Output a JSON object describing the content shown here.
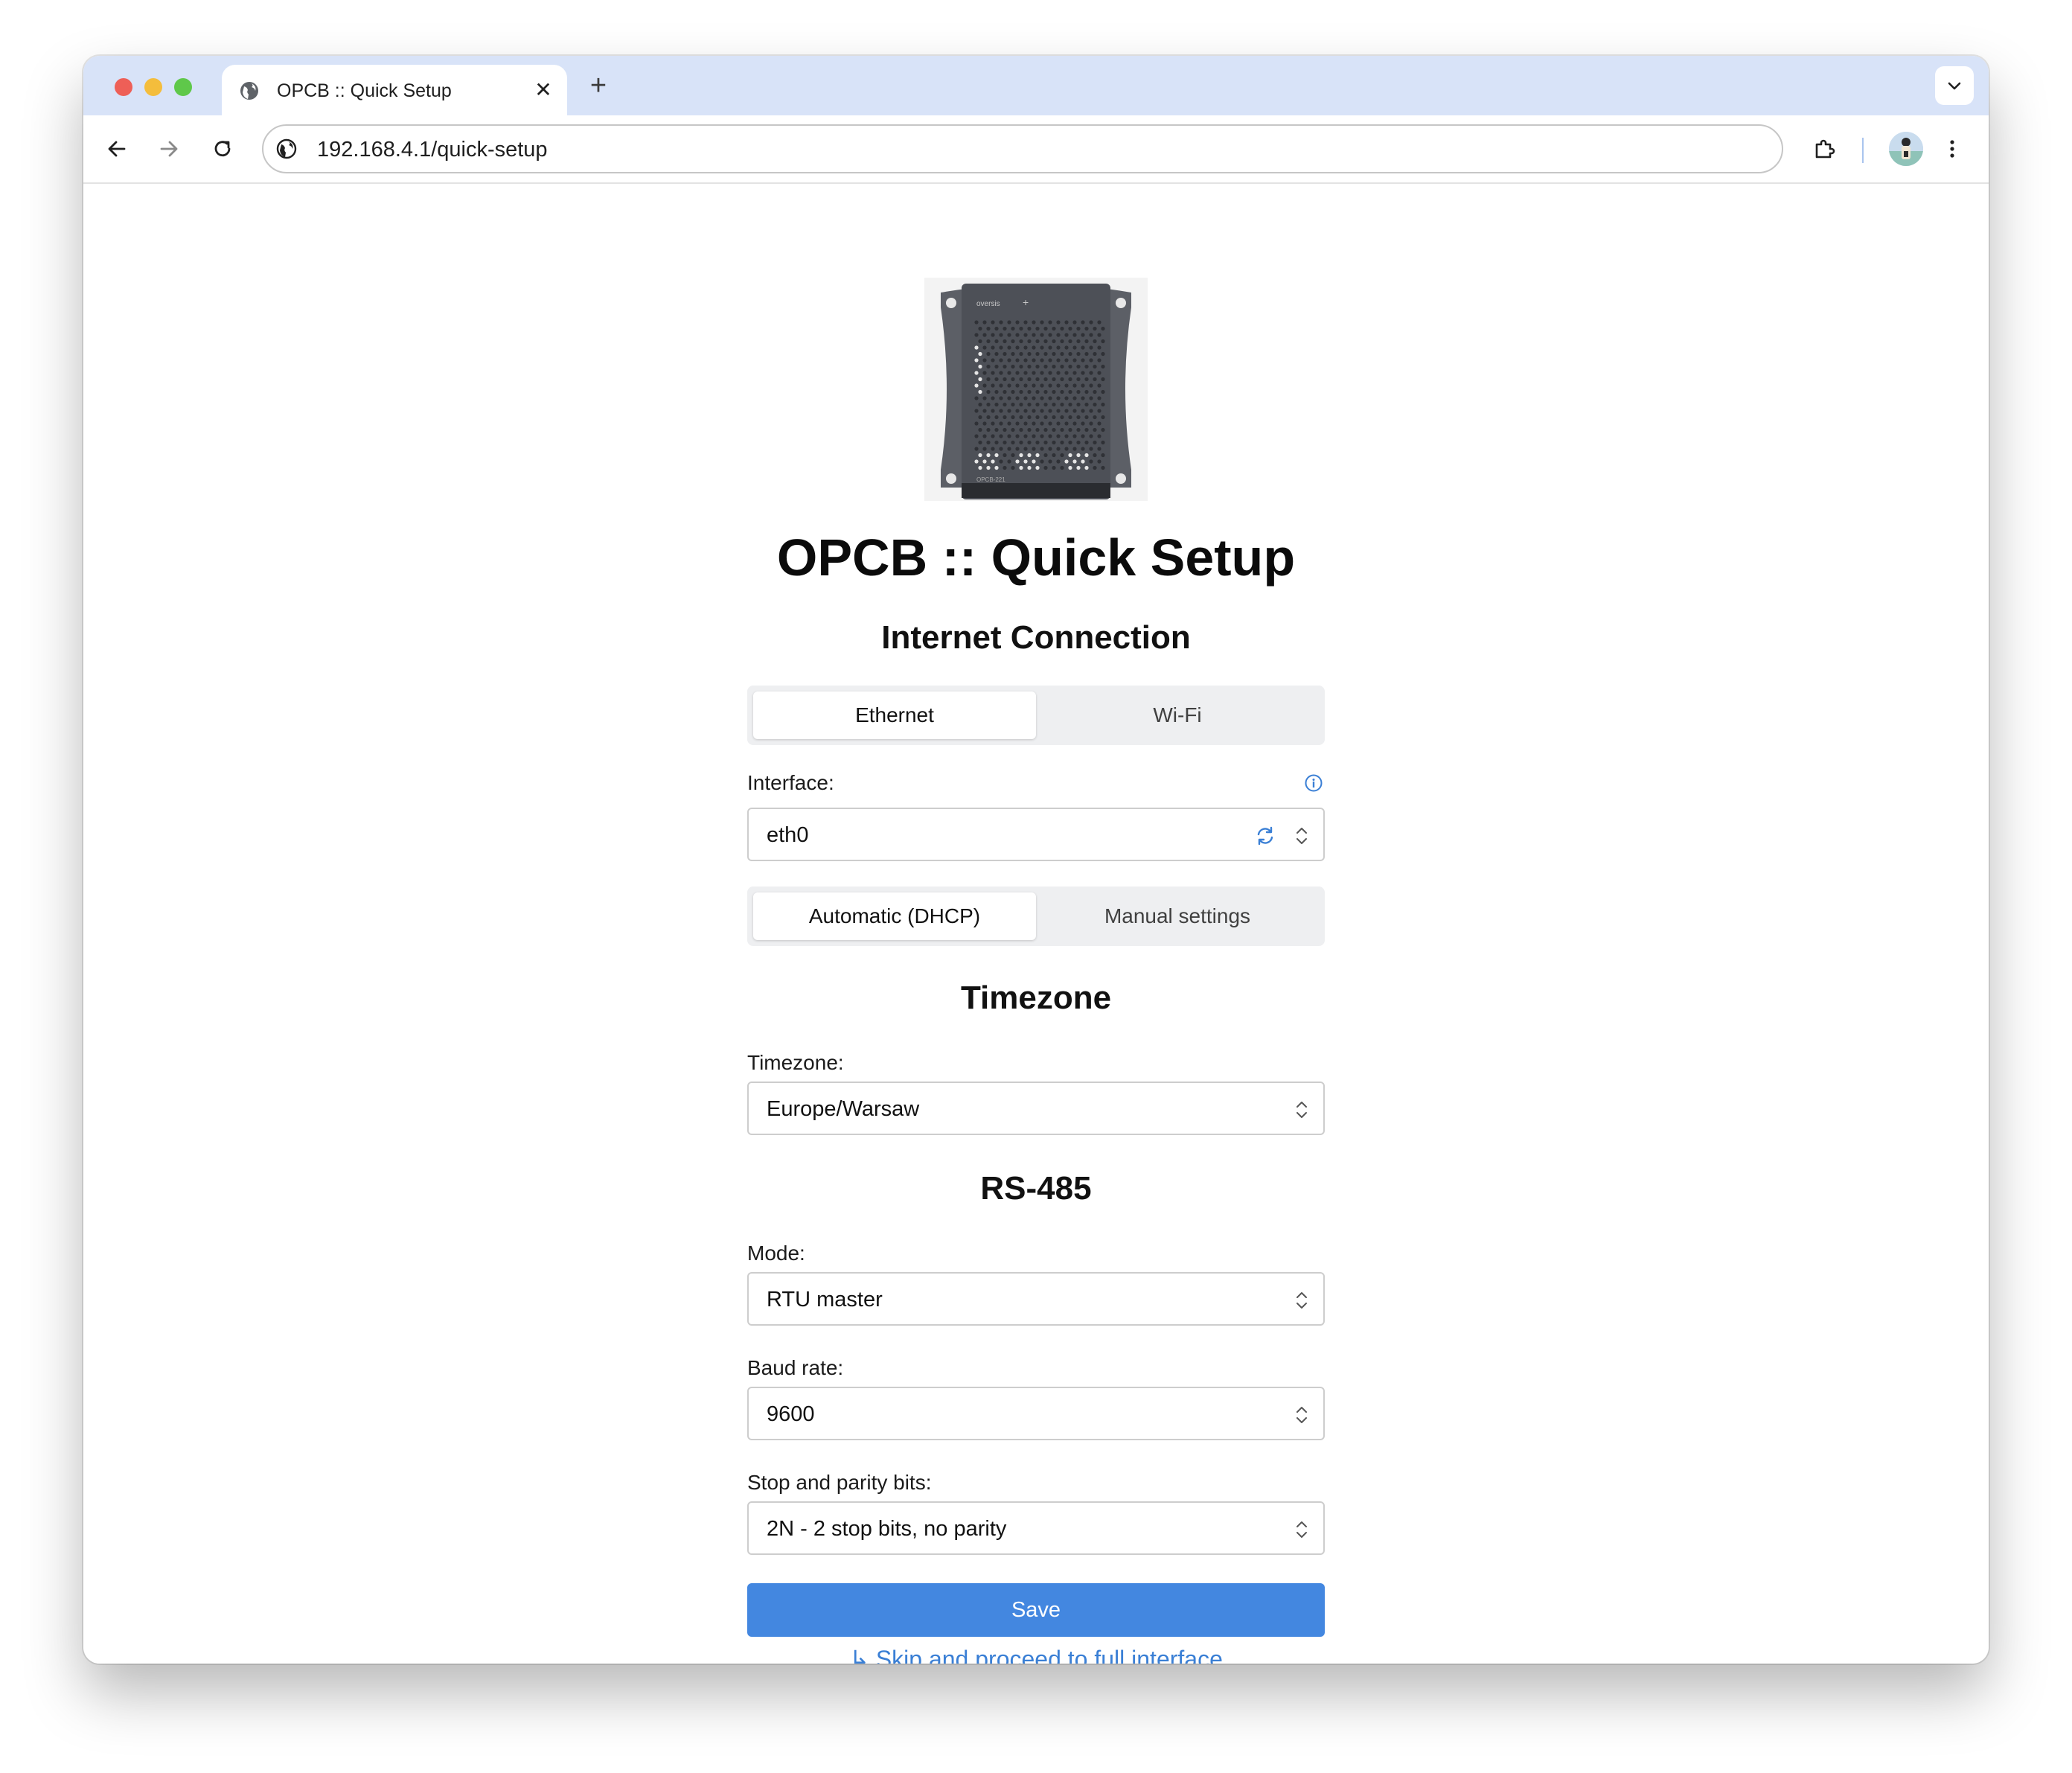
{
  "browser": {
    "tab_title": "OPCB :: Quick Setup",
    "tab_close": "✕",
    "new_tab": "+",
    "url": "192.168.4.1/quick-setup"
  },
  "page": {
    "title": "OPCB :: Quick Setup",
    "product_image": {
      "brand": "oversis",
      "model": "OPCB-221"
    }
  },
  "internet": {
    "heading": "Internet Connection",
    "connection_tabs": [
      {
        "label": "Ethernet",
        "active": true
      },
      {
        "label": "Wi-Fi",
        "active": false
      }
    ],
    "interface_label": "Interface:",
    "interface_value": "eth0",
    "addressing_tabs": [
      {
        "label": "Automatic (DHCP)",
        "active": true
      },
      {
        "label": "Manual settings",
        "active": false
      }
    ]
  },
  "timezone": {
    "heading": "Timezone",
    "label": "Timezone:",
    "value": "Europe/Warsaw"
  },
  "rs485": {
    "heading": "RS-485",
    "mode_label": "Mode:",
    "mode_value": "RTU master",
    "baud_label": "Baud rate:",
    "baud_value": "9600",
    "bits_label": "Stop and parity bits:",
    "bits_value": "2N - 2 stop bits, no parity"
  },
  "actions": {
    "save": "Save",
    "skip": "↳ Skip and proceed to full interface"
  },
  "colors": {
    "accent": "#4387e0",
    "link": "#3a7fd5",
    "tabbar": "#d8e3f8"
  }
}
